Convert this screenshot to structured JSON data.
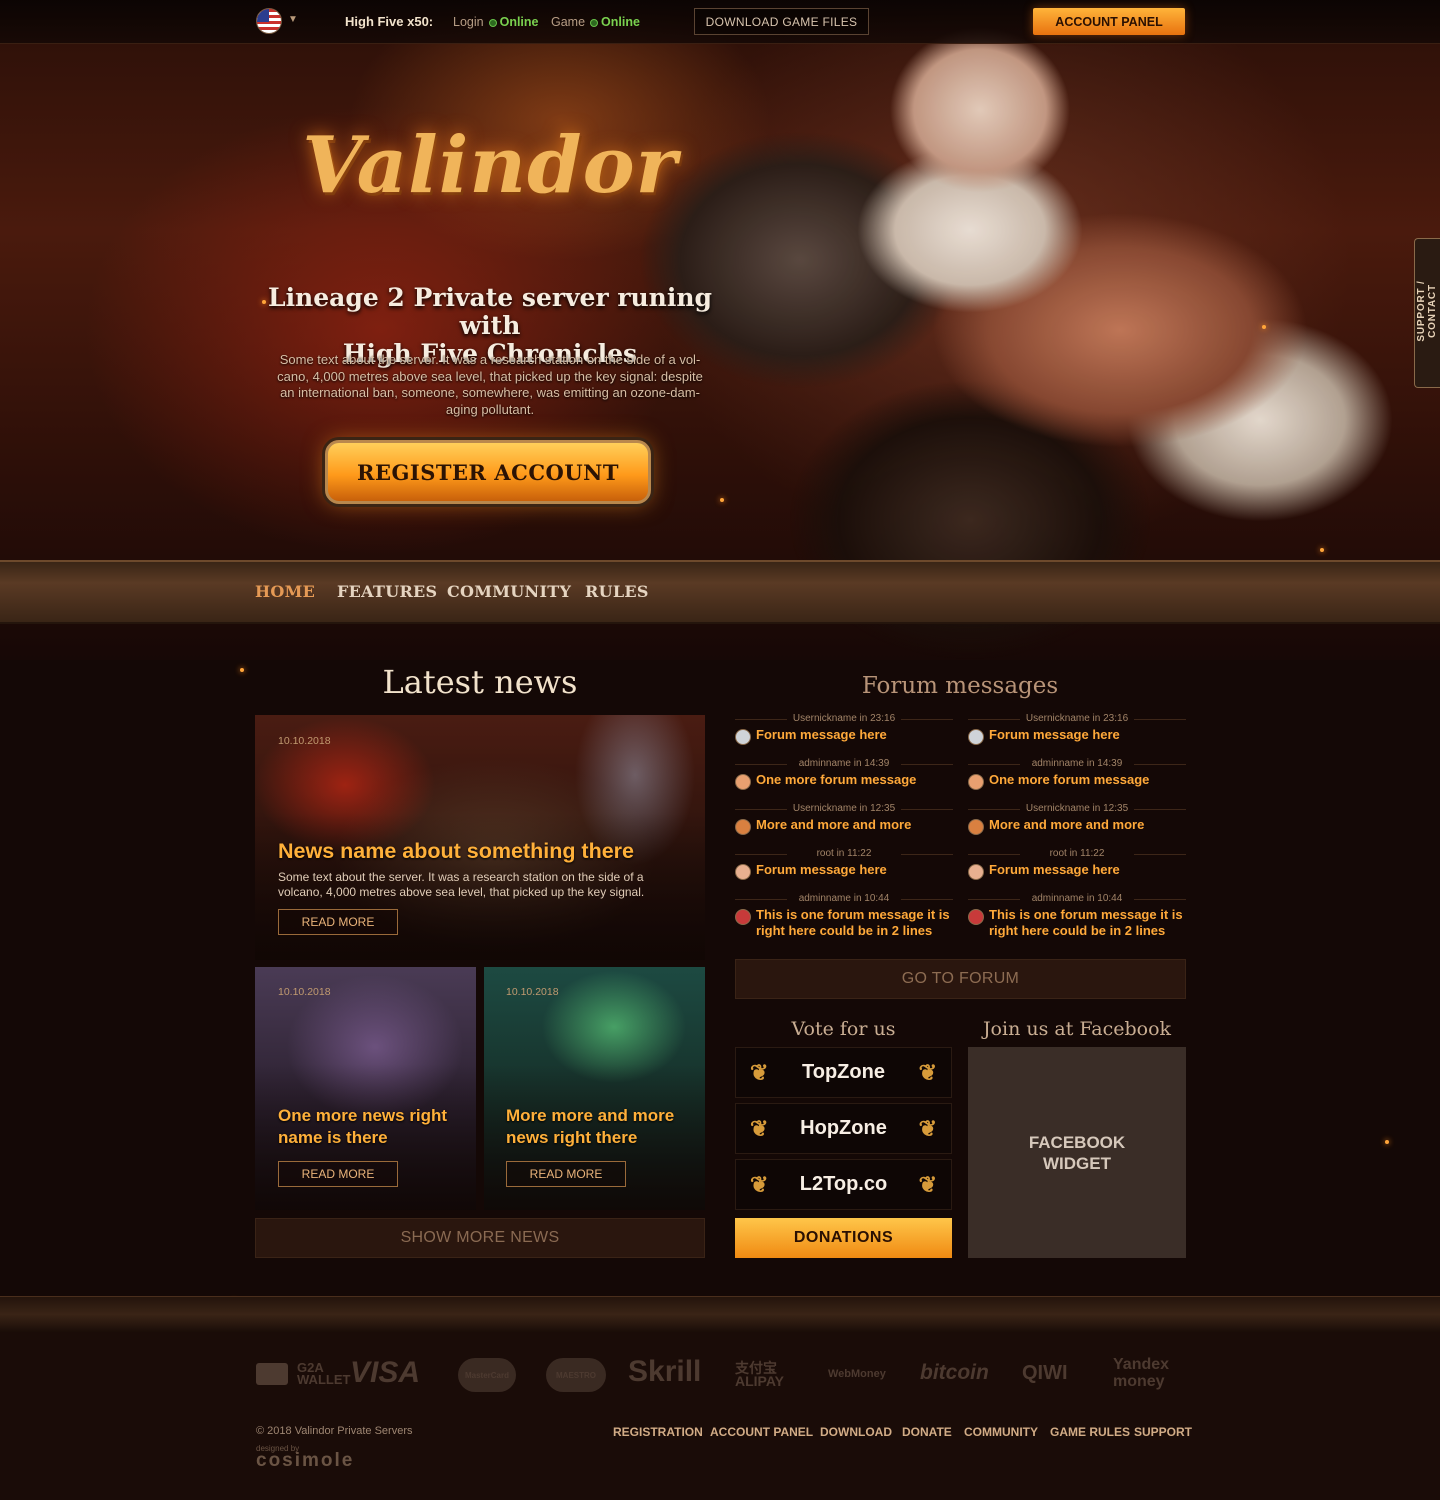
{
  "topbar": {
    "language": "EN",
    "server_rate": "High Five x50:",
    "login_label": "Login",
    "login_status": "Online",
    "game_label": "Game",
    "game_status": "Online",
    "download_label": "DOWNLOAD GAME FILES",
    "account_label": "ACCOUNT PANEL"
  },
  "hero": {
    "logo_text": "Valindor",
    "title_line1": "Lineage 2 Private server runing with",
    "title_line2": "High Five Chronicles",
    "text_line1": "Some text about the server. It was a research station on the side of a vol-",
    "text_line2": "cano, 4,000 metres above sea level, that picked up the key signal: despite",
    "text_line3": "an international ban, someone, somewhere, was emitting an ozone-dam-",
    "text_line4": "aging pollutant.",
    "register_label": "REGISTER ACCOUNT"
  },
  "nav": {
    "items": [
      "HOME",
      "FEATURES",
      "COMMUNITY",
      "RULES"
    ]
  },
  "support_label": "SUPPORT / CONTACT",
  "news": {
    "title": "Latest news",
    "main": {
      "date": "10.10.2018",
      "title": "News name about something there",
      "text_line1": "Some text about the server. It was a research station on the side of a",
      "text_line2": "volcano, 4,000 metres above sea level, that picked up the key signal.",
      "read_more": "READ MORE"
    },
    "small": [
      {
        "date": "10.10.2018",
        "title_line1": "One more news right",
        "title_line2": "name is there",
        "read_more": "READ MORE"
      },
      {
        "date": "10.10.2018",
        "title_line1": "More more and more",
        "title_line2": "news right there",
        "read_more": "READ MORE"
      }
    ],
    "show_more": "SHOW MORE NEWS"
  },
  "forum": {
    "title": "Forum messages",
    "columns": [
      [
        {
          "meta": "Usernickname in 23:16",
          "msg": "Forum message here",
          "avatar_color": "#cfd3d8"
        },
        {
          "meta": "adminname in 14:39",
          "msg": "One more forum message",
          "avatar_color": "#e8a070"
        },
        {
          "meta": "Usernickname in 12:35",
          "msg": "More and more and more",
          "avatar_color": "#d98040"
        },
        {
          "meta": "root in 11:22",
          "msg": "Forum message here",
          "avatar_color": "#e8b090"
        },
        {
          "meta": "adminname in 10:44",
          "msg": "This is one forum message it is right here could be in 2 lines",
          "avatar_color": "#c83a3a"
        }
      ],
      [
        {
          "meta": "Usernickname in 23:16",
          "msg": "Forum message here",
          "avatar_color": "#cfd3d8"
        },
        {
          "meta": "adminname in 14:39",
          "msg": "One more forum message",
          "avatar_color": "#e8a070"
        },
        {
          "meta": "Usernickname in 12:35",
          "msg": "More and more and more",
          "avatar_color": "#d98040"
        },
        {
          "meta": "root in 11:22",
          "msg": "Forum message here",
          "avatar_color": "#e8b090"
        },
        {
          "meta": "adminname in 10:44",
          "msg": "This is one forum message it is right here could be in 2 lines",
          "avatar_color": "#c83a3a"
        }
      ]
    ],
    "go_to_forum": "GO TO FORUM"
  },
  "vote": {
    "title": "Vote for us",
    "sites": [
      "TopZone",
      "HopZone",
      "L2Top.co"
    ],
    "donate": "DONATIONS"
  },
  "facebook": {
    "title": "Join us at Facebook",
    "widget_line1": "FACEBOOK",
    "widget_line2": "WIDGET"
  },
  "payments": [
    "G2A WALLET",
    "VISA",
    "MasterCard",
    "MAESTRO",
    "Skrill",
    "支付宝 ALIPAY",
    "WebMoney",
    "bitcoin",
    "QIWI",
    "Yandex money"
  ],
  "footer": {
    "copyright": "© 2018 Valindor Private Servers",
    "designed_by": "designed by",
    "designer": "cosimole",
    "links": [
      "REGISTRATION",
      "ACCOUNT PANEL",
      "DOWNLOAD",
      "DONATE",
      "COMMUNITY",
      "GAME RULES",
      "SUPPORT"
    ]
  },
  "colors": {
    "accent": "#ffa93a",
    "online": "#7ad14f",
    "background": "#140806"
  }
}
